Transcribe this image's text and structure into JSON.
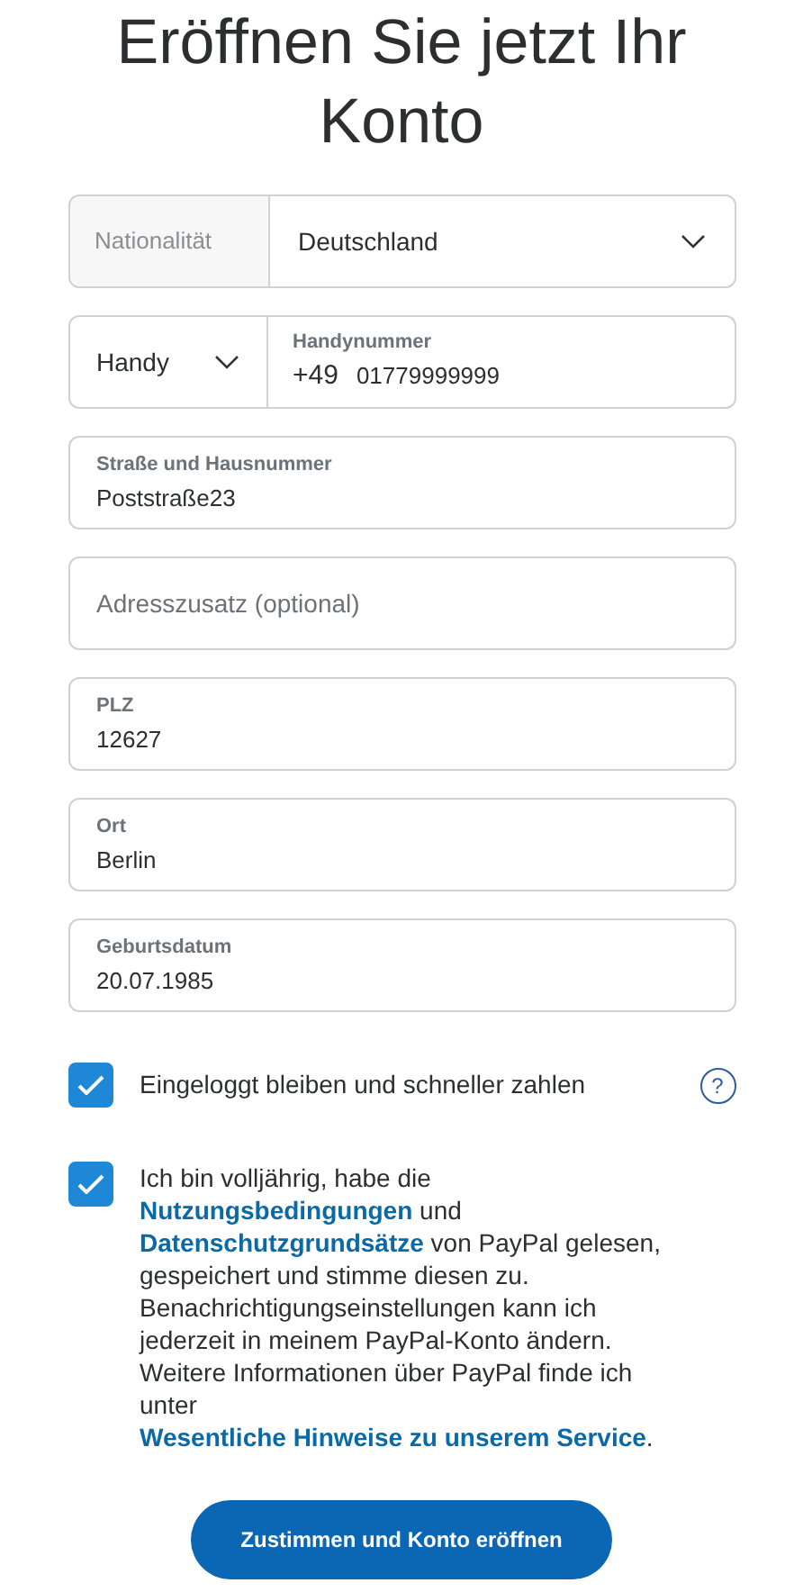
{
  "title": "Eröffnen Sie jetzt Ihr Konto",
  "fields": [
    {
      "kind": "nationality",
      "label": "Nationalität",
      "value": "Deutschland"
    },
    {
      "kind": "phone",
      "type": "Handy",
      "label": "Handynummer",
      "prefix": "+49",
      "value": "01779999999"
    },
    {
      "kind": "text",
      "label": "Straße und Hausnummer",
      "value": "Poststraße23"
    },
    {
      "kind": "empty",
      "placeholder": "Adresszusatz (optional)"
    },
    {
      "kind": "text",
      "label": "PLZ",
      "value": "12627"
    },
    {
      "kind": "text",
      "label": "Ort",
      "value": "Berlin"
    },
    {
      "kind": "text",
      "label": "Geburtsdatum",
      "value": "20.07.1985"
    }
  ],
  "stay_logged_in": {
    "label": "Eingeloggt bleiben und schneller zahlen",
    "checked": true,
    "help": "?"
  },
  "terms": {
    "checked": true,
    "segments": [
      {
        "kind": "text",
        "text": "Ich bin volljährig, habe die "
      },
      {
        "kind": "link",
        "text": "Nutzungsbedingungen"
      },
      {
        "kind": "text",
        "text": " und "
      },
      {
        "kind": "link",
        "text": "Datenschutzgrundsätze"
      },
      {
        "kind": "text",
        "text": " von PayPal gelesen, gespeichert und stimme diesen zu. Benachrichtigungseinstellungen kann ich jederzeit in meinem PayPal-Konto ändern. Weitere Informationen über PayPal finde ich unter "
      },
      {
        "kind": "link",
        "text": "Wesentliche Hinweise zu unserem Service"
      },
      {
        "kind": "text",
        "text": "."
      }
    ]
  },
  "submit": "Zustimmen und Konto eröffnen"
}
